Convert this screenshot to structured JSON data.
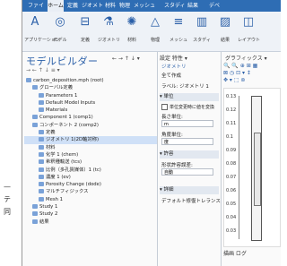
{
  "background_doc": {
    "text_lines": [
      "—",
      "テ",
      "同"
    ]
  },
  "ribbon": {
    "tabs": [
      "ファイル",
      "ホーム",
      "定義",
      "ジオメトリ",
      "材料",
      "物理",
      "メッシュ",
      "スタディ",
      "結果",
      "デベロッパー"
    ],
    "active_tab": "ホーム",
    "buttons": [
      {
        "icon": "A",
        "label": "アプリケーション"
      },
      {
        "icon": "◎",
        "label": "モデル"
      },
      {
        "icon": "⊟",
        "label": "定義"
      },
      {
        "icon": "⚗",
        "label": "ジオメトリ"
      },
      {
        "icon": "✺",
        "label": "材料"
      },
      {
        "icon": "△",
        "label": "物理"
      },
      {
        "icon": "≡",
        "label": "メッシュ"
      },
      {
        "icon": "▥",
        "label": "スタディ"
      },
      {
        "icon": "▨",
        "label": "結果"
      },
      {
        "icon": "◫",
        "label": "レイアウト"
      }
    ]
  },
  "model_builder": {
    "title": "モデルビルダー",
    "header_icons": "← → ↑ ↓ ▾",
    "toolbar": "→ ← ↑ ↓ ≡ ▾",
    "tree": [
      {
        "label": "carbon_deposition.mph (root)",
        "indent": 0,
        "selected": false
      },
      {
        "label": "グローバル定義",
        "indent": 1,
        "selected": false
      },
      {
        "label": "Parameters 1",
        "indent": 2,
        "selected": false
      },
      {
        "label": "Default Model Inputs",
        "indent": 2,
        "selected": false
      },
      {
        "label": "Materials",
        "indent": 2,
        "selected": false
      },
      {
        "label": "Component 1 (comp1)",
        "indent": 1,
        "selected": false
      },
      {
        "label": "コンポーネント 2 (comp2)",
        "indent": 1,
        "selected": false
      },
      {
        "label": "定義",
        "indent": 2,
        "selected": false
      },
      {
        "label": "ジオメトリ 1(2D軸対称)",
        "indent": 2,
        "selected": true
      },
      {
        "label": "材料",
        "indent": 2,
        "selected": false
      },
      {
        "label": "化学 1 (chem)",
        "indent": 2,
        "selected": false
      },
      {
        "label": "希釈種輸送 (tcs)",
        "indent": 2,
        "selected": false
      },
      {
        "label": "比例（多孔質媒体）1 (tc)",
        "indent": 2,
        "selected": false
      },
      {
        "label": "濃度 1 (ev)",
        "indent": 2,
        "selected": false
      },
      {
        "label": "Porosity Change (dode)",
        "indent": 2,
        "selected": false
      },
      {
        "label": "マルチフィジックス",
        "indent": 2,
        "selected": false
      },
      {
        "label": "Mesh 1",
        "indent": 2,
        "selected": false
      },
      {
        "label": "Study 1",
        "indent": 1,
        "selected": false
      },
      {
        "label": "Study 2",
        "indent": 1,
        "selected": false
      },
      {
        "label": "結果",
        "indent": 1,
        "selected": false
      }
    ]
  },
  "settings": {
    "tabs": "設定  特性  ▾",
    "subtitle": "ジオメトリ",
    "build_all": "全て作成",
    "label_field": "ラベル: ジオメトリ 1",
    "section_units": "▾ 単位",
    "chk_scale": "単位変更時に値を変換",
    "length_unit_label": "長さ単位:",
    "length_unit": "m",
    "angle_unit_label": "角度単位:",
    "angle_unit": "度",
    "section_tolerance": "▾ 許容",
    "tolerance_label": "形状許容誤差:",
    "tolerance": "自動",
    "section_detail": "▾ 詳細",
    "default_repair": "デフォルト修復トレランス"
  },
  "graphics": {
    "tabs": "グラフィックス  ▾",
    "tools": "🔍 🔍 ⊕ ⊞ ▦\n⊠ ◷ ⊡ ▾ ↕\n✥ ▾ ⬚ ⊚",
    "y_ticks": [
      "0.13",
      "0.12",
      "0.11",
      "0.1",
      "0.09",
      "0.08",
      "0.07",
      "0.06",
      "0.05",
      "0.04",
      "0.03"
    ],
    "bottom_label": "描画  ログ"
  }
}
